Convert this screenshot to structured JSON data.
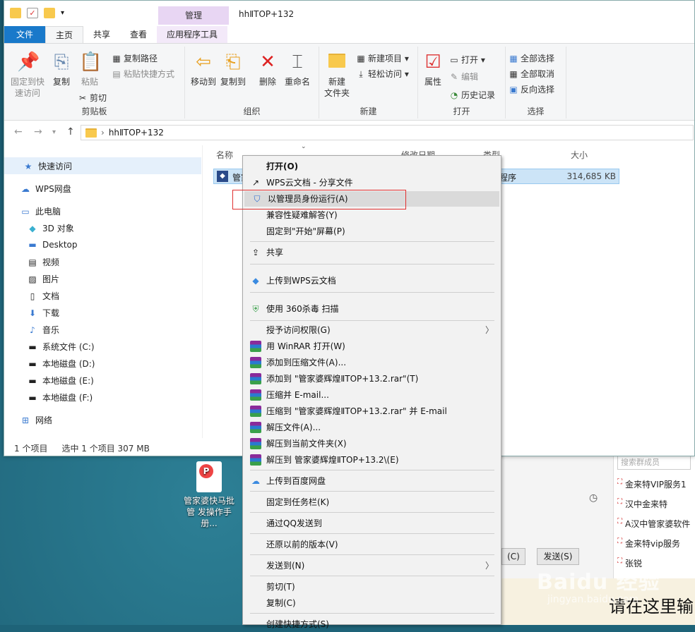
{
  "window": {
    "title": "hhⅡTOP+132",
    "manage_tab": "管理",
    "tabs": [
      "文件",
      "主页",
      "共享",
      "查看",
      "应用程序工具"
    ]
  },
  "ribbon": {
    "clipboard": {
      "label": "剪贴板",
      "pin": "固定到快\n速访问",
      "copy": "复制",
      "paste": "粘贴",
      "copy_path": "复制路径",
      "paste_shortcut": "粘贴快捷方式",
      "cut": "剪切"
    },
    "organize": {
      "label": "组织",
      "move_to": "移动到",
      "copy_to": "复制到",
      "delete": "删除",
      "rename": "重命名"
    },
    "new": {
      "label": "新建",
      "new_folder": "新建\n文件夹",
      "new_item": "新建项目 ▾",
      "easy_access": "轻松访问 ▾"
    },
    "open": {
      "label": "打开",
      "properties": "属性",
      "open": "打开 ▾",
      "edit": "编辑",
      "history": "历史记录"
    },
    "select": {
      "label": "选择",
      "select_all": "全部选择",
      "select_none": "全部取消",
      "invert": "反向选择"
    }
  },
  "address": {
    "path": "hhⅡTOP+132",
    "separator": "›"
  },
  "nav": {
    "items": [
      "快速访问",
      "WPS网盘",
      "此电脑",
      "3D 对象",
      "Desktop",
      "视频",
      "图片",
      "文档",
      "下载",
      "音乐",
      "系统文件 (C:)",
      "本地磁盘 (D:)",
      "本地磁盘 (E:)",
      "本地磁盘 (F:)",
      "网络"
    ]
  },
  "columns": {
    "name": "名称",
    "date": "修改日期",
    "type": "类型",
    "size": "大小"
  },
  "file": {
    "name": "管家",
    "type": "程序",
    "size": "314,685 KB"
  },
  "status": {
    "count": "1 个项目",
    "selected": "选中 1 个项目  307 MB"
  },
  "context_menu": {
    "items": [
      "打开(O)",
      "WPS云文档 - 分享文件",
      "以管理员身份运行(A)",
      "兼容性疑难解答(Y)",
      "固定到\"开始\"屏幕(P)",
      "共享",
      "上传到WPS云文档",
      "使用 360杀毒 扫描",
      "授予访问权限(G)",
      "用 WinRAR 打开(W)",
      "添加到压缩文件(A)...",
      "添加到 \"管家婆辉煌ⅡTOP+13.2.rar\"(T)",
      "压缩并 E-mail...",
      "压缩到 \"管家婆辉煌ⅡTOP+13.2.rar\" 并 E-mail",
      "解压文件(A)...",
      "解压到当前文件夹(X)",
      "解压到 管家婆辉煌ⅡTOP+13.2\\(E)",
      "上传到百度网盘",
      "固定到任务栏(K)",
      "通过QQ发送到",
      "还原以前的版本(V)",
      "发送到(N)",
      "剪切(T)",
      "复制(C)",
      "创建快捷方式(S)"
    ]
  },
  "desktop_icon": {
    "label": "管家婆快马批 管 发操作手册..."
  },
  "chat": {
    "search_placeholder": "搜索群成员",
    "members": [
      "金来特VIP服务1",
      "汉中金来特",
      "A汉中管家婆软件",
      "金来特vip服务",
      "张锐"
    ],
    "close_btn": "(C)",
    "send_btn": "发送(S)",
    "input_hint": "请在这里输",
    "watermark": "Baidu 经验",
    "watermark_url": "jingyan.baidu.com"
  },
  "colors": {
    "file_tab": "#1979ca",
    "manage": "#e8d6f3",
    "highlight_border": "#e03030",
    "selection": "#cce4f7"
  }
}
